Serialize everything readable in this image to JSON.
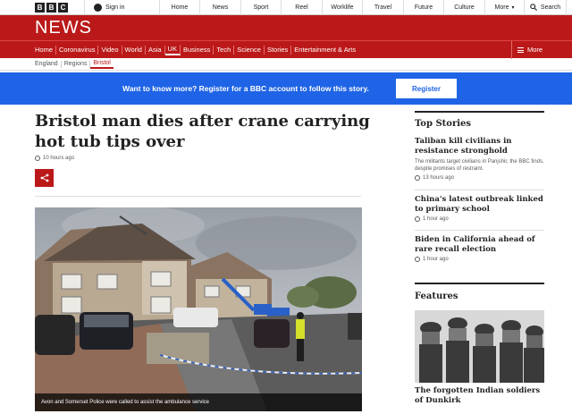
{
  "topbar": {
    "logo_letters": [
      "B",
      "B",
      "C"
    ],
    "signin": "Sign in",
    "nav": [
      "Home",
      "News",
      "Sport",
      "Reel",
      "Worklife",
      "Travel",
      "Future",
      "Culture"
    ],
    "more": "More",
    "search": "Search"
  },
  "banner": {
    "title": "NEWS"
  },
  "rednav": {
    "links": [
      "Home",
      "Coronavirus",
      "Video",
      "World",
      "Asia",
      "UK",
      "Business",
      "Tech",
      "Science",
      "Stories",
      "Entertainment & Arts"
    ],
    "active": "UK",
    "more": "More"
  },
  "subnav": {
    "links": [
      "England",
      "Regions",
      "Bristol"
    ],
    "active": "Bristol"
  },
  "register": {
    "message": "Want to know more? Register for a BBC account to follow this story.",
    "button": "Register"
  },
  "article": {
    "headline": "Bristol man dies after crane carrying hot tub tips over",
    "time": "10 hours ago",
    "caption": "Avon and Somerset Police were called to assist the ambulance service"
  },
  "sidebar": {
    "top_stories_heading": "Top Stories",
    "stories": [
      {
        "title": "Taliban kill civilians in resistance stronghold",
        "summary": "The militants target civilians in Panjshir, the BBC finds, despite promises of restraint.",
        "time": "13 hours ago"
      },
      {
        "title": "China's latest outbreak linked to primary school",
        "summary": "",
        "time": "1 hour ago"
      },
      {
        "title": "Biden in California ahead of rare recall election",
        "summary": "",
        "time": "1 hour ago"
      }
    ],
    "features_heading": "Features",
    "feature_title": "The forgotten Indian soldiers of Dunkirk"
  },
  "colors": {
    "brand_red": "#bb1919",
    "register_blue": "#1f64e6"
  }
}
